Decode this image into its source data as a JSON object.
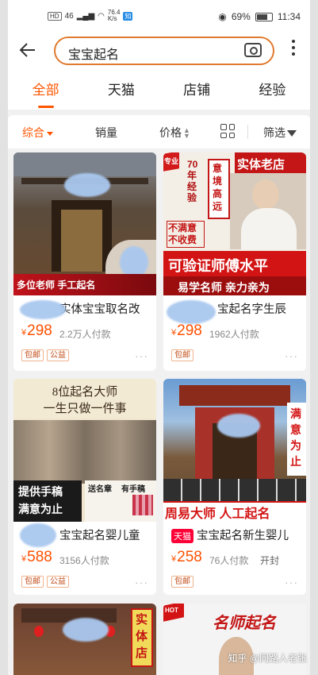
{
  "status": {
    "network": "46",
    "speed": "76.4\nK/s",
    "battery": "69%",
    "time": "11:34",
    "hd": "HD",
    "app_badge": "知"
  },
  "header": {
    "search_query": "宝宝起名"
  },
  "tabs": [
    "全部",
    "天猫",
    "店铺",
    "经验"
  ],
  "sort": {
    "overall": "综合",
    "sales": "销量",
    "price": "价格",
    "filter": "筛选"
  },
  "products": [
    {
      "image_texts": [
        "多位老师  手工起名"
      ],
      "title": "实体宝宝取名改",
      "price_symbol": "¥",
      "price": "298",
      "sold": "2.2万人付款",
      "tags": [
        "包邮",
        "公益"
      ]
    },
    {
      "image_texts": [
        "专业",
        "70年经验",
        "意境高远",
        "实体老店",
        "不满意不收费",
        "可验证师傅水平",
        "易学名师  亲力亲为"
      ],
      "title": "宝起名字生辰",
      "price_symbol": "¥",
      "price": "298",
      "sold": "1962人付款",
      "tags": [
        "包邮"
      ]
    },
    {
      "image_texts": [
        "8位起名大师",
        "一生只做一件事",
        "提供手稿",
        "满意为止",
        "送名章",
        "有手稿"
      ],
      "title": "宝宝起名婴儿童",
      "price_symbol": "¥",
      "price": "588",
      "sold": "3156人付款",
      "tags": [
        "包邮",
        "公益"
      ]
    },
    {
      "image_texts": [
        "满意为止",
        "周易大师  人工起名"
      ],
      "badge": "天猫",
      "title": "宝宝起名新生婴儿",
      "price_symbol": "¥",
      "price": "258",
      "sold": "76人付款",
      "extra": "开封",
      "tags": [
        "包邮"
      ]
    },
    {
      "image_texts": [
        "实体店"
      ]
    },
    {
      "image_texts": [
        "HOT",
        "名师起名"
      ]
    }
  ],
  "watermark": "知乎 @同路人老张",
  "colors": {
    "accent": "#ff5500",
    "price": "#ff5000",
    "search_border": "#e07a2f"
  }
}
